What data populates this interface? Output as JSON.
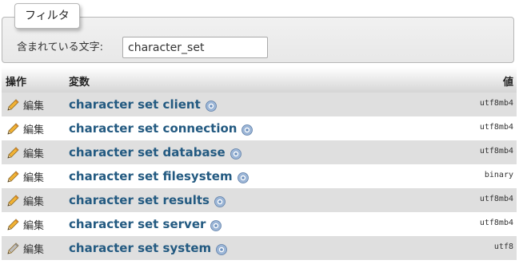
{
  "filter": {
    "legend": "フィルタ",
    "label": "含まれている文字:",
    "value": "character_set"
  },
  "table": {
    "headers": {
      "ops": "操作",
      "variable": "変数",
      "value": "値"
    },
    "edit_label": "編集",
    "rows": [
      {
        "name": "character set client",
        "value": "utf8mb4"
      },
      {
        "name": "character set connection",
        "value": "utf8mb4"
      },
      {
        "name": "character set database",
        "value": "utf8mb4"
      },
      {
        "name": "character set filesystem",
        "value": "binary"
      },
      {
        "name": "character set results",
        "value": "utf8mb4"
      },
      {
        "name": "character set server",
        "value": "utf8mb4"
      },
      {
        "name": "character set system",
        "value": "utf8"
      }
    ]
  },
  "icons": {
    "edit": "pencil-icon",
    "doc": "help-icon"
  },
  "colors": {
    "link": "#235a81",
    "row_odd": "#dfdfdf",
    "row_even": "#ffffff"
  }
}
